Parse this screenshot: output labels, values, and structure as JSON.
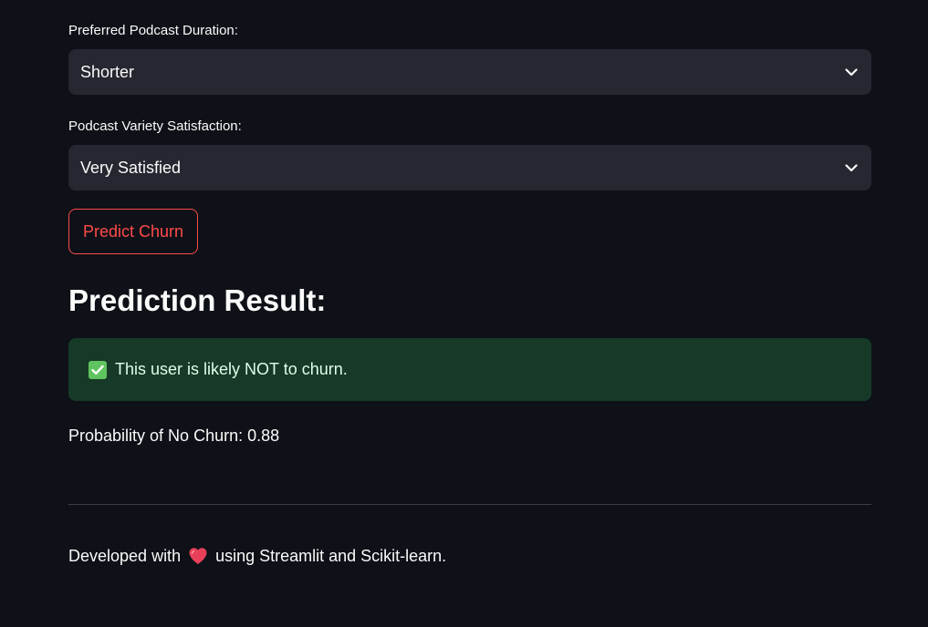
{
  "form": {
    "duration": {
      "label": "Preferred Podcast Duration:",
      "value": "Shorter"
    },
    "variety": {
      "label": "Podcast Variety Satisfaction:",
      "value": "Very Satisfied"
    },
    "predict_button": "Predict Churn"
  },
  "result": {
    "heading": "Prediction Result:",
    "alert_text": "This user is likely NOT to churn.",
    "probability_text": "Probability of No Churn: 0.88"
  },
  "footer": {
    "text_before": "Developed with",
    "text_after": "using Streamlit and Scikit-learn."
  },
  "colors": {
    "background": "#0e1117",
    "select_bg": "#262730",
    "accent": "#ff4b4b",
    "success_bg": "#173928",
    "success_icon": "#5fc45f",
    "heart": "#e8405a"
  },
  "icons": {
    "select_chevron": "chevron-down-icon",
    "alert_icon": "check-box-icon",
    "footer_icon": "heart-icon"
  }
}
